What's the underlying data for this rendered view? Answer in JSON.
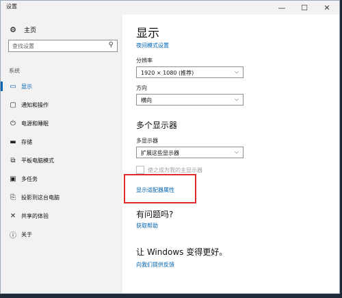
{
  "window": {
    "title": "设置",
    "minimize": "—",
    "maximize": "☐",
    "close": "✕"
  },
  "sidebar": {
    "home_label": "主页",
    "search_placeholder": "查找设置",
    "section_label": "系统",
    "items": [
      {
        "label": "显示",
        "icon": "monitor-icon",
        "selected": true
      },
      {
        "label": "通知和操作",
        "icon": "notification-icon",
        "selected": false
      },
      {
        "label": "电源和睡眠",
        "icon": "power-icon",
        "selected": false
      },
      {
        "label": "存储",
        "icon": "storage-icon",
        "selected": false
      },
      {
        "label": "平板电脑模式",
        "icon": "tablet-icon",
        "selected": false
      },
      {
        "label": "多任务",
        "icon": "multitask-icon",
        "selected": false
      },
      {
        "label": "投影到这台电脑",
        "icon": "project-icon",
        "selected": false
      },
      {
        "label": "共享的体验",
        "icon": "shared-experience-icon",
        "selected": false
      },
      {
        "label": "关于",
        "icon": "info-icon",
        "selected": false
      }
    ]
  },
  "main": {
    "title": "显示",
    "night_light_link": "夜间模式设置",
    "resolution_label": "分辨率",
    "resolution_value": "1920 × 1080 (推荐)",
    "orientation_label": "方向",
    "orientation_value": "横向",
    "multi_display_heading": "多个显示器",
    "multi_display_label": "多显示器",
    "multi_display_value": "扩展这些显示器",
    "main_display_checkbox": "使之成为我的主显示器",
    "adapter_link": "显示适配器属性",
    "question_heading": "有问题吗?",
    "help_link": "获取帮助",
    "improve_heading": "让 Windows 变得更好。",
    "feedback_link": "向我们提供反馈"
  },
  "colors": {
    "accent": "#0063b1",
    "highlight": "#e0292b"
  }
}
